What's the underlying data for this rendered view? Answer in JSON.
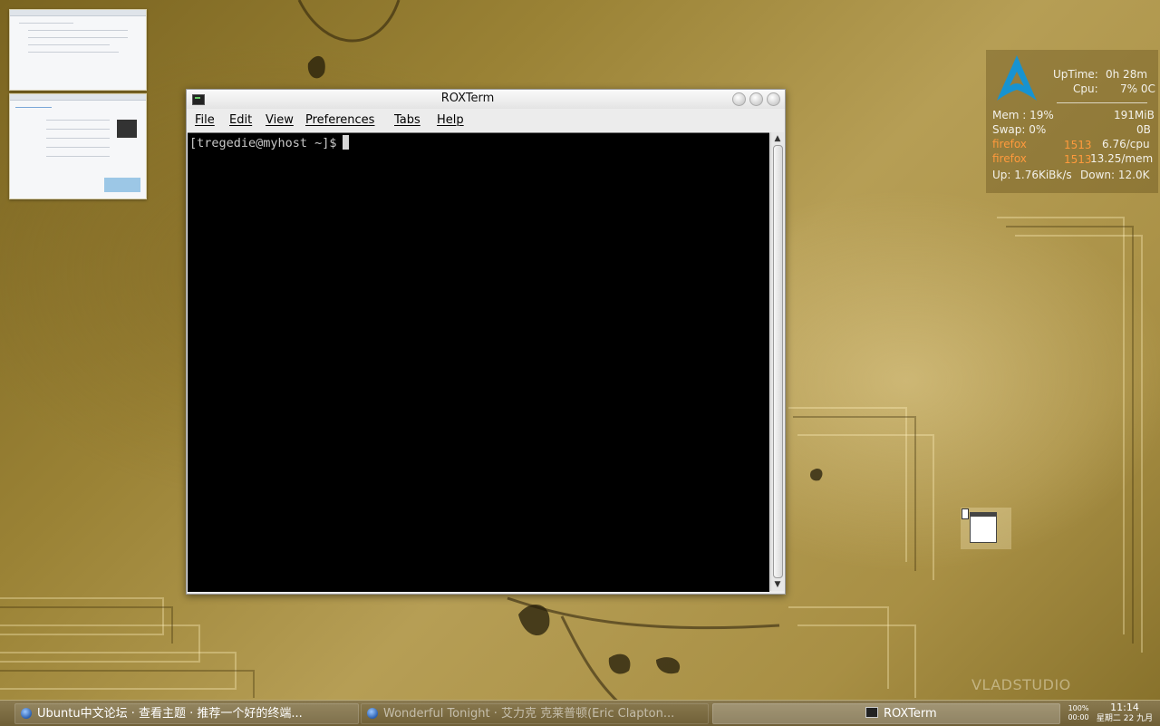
{
  "desktop": {
    "watermark": "VLADSTUDIO"
  },
  "thumbnails": [
    {
      "name": "workspace-preview-1"
    },
    {
      "name": "workspace-preview-2"
    }
  ],
  "terminal": {
    "title": "ROXTerm",
    "menu": [
      "File",
      "Edit",
      "View",
      "Preferences",
      "Tabs",
      "Help"
    ],
    "prompt": "[tregedie@myhost ~]$"
  },
  "conky": {
    "uptime_label": "UpTime:",
    "uptime_value": "0h 28m",
    "cpu_label": "Cpu:",
    "cpu_value": "7% 0C",
    "mem_label": "Mem : 19%",
    "mem_value": "191MiB",
    "swap_label": "Swap: 0%",
    "swap_value": "0B",
    "proc1_name": "firefox",
    "proc1_pid": "1513",
    "proc1_value": "6.76/cpu",
    "proc2_name": "firefox",
    "proc2_pid": "1513",
    "proc2_value": "13.25/mem",
    "up_label": "Up: 1.76KiBk/s",
    "down_label": "Down: 12.0K",
    "accent_color": "#ff9a3c",
    "logo_color": "#1793d1"
  },
  "taskbar": {
    "tasks": [
      {
        "label": "Ubuntu中文论坛 · 查看主题 · 推荐一个好的终端..."
      },
      {
        "label": "Wonderful Tonight · 艾力克 克莱普顿(Eric Clapton..."
      },
      {
        "label": "ROXTerm"
      }
    ],
    "battery": "100%",
    "battery_time": "00:00",
    "time": "11:14",
    "date": "星期二 22 九月"
  }
}
